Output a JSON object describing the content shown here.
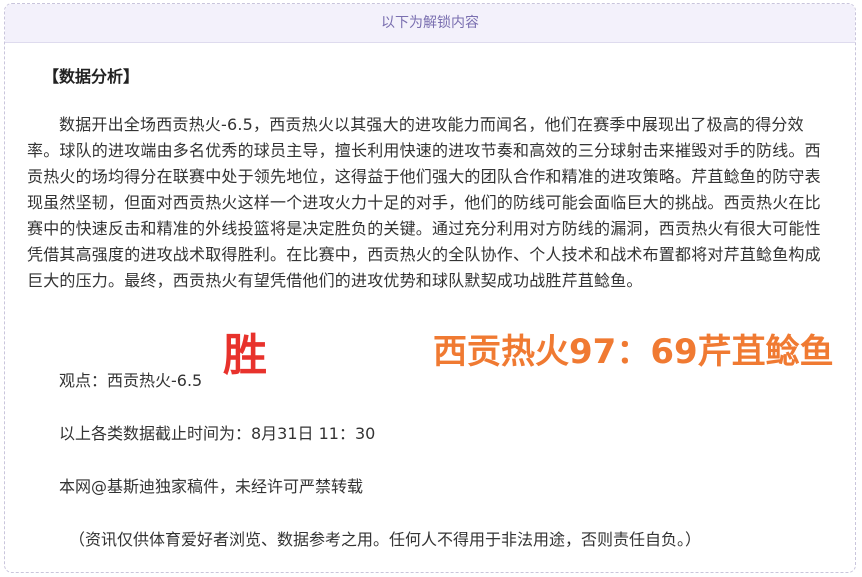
{
  "banner": {
    "label": "以下为解锁内容"
  },
  "article": {
    "heading": "【数据分析】",
    "body": "数据开出全场西贡热火-6.5，西贡热火以其强大的进攻能力而闻名，他们在赛季中展现出了极高的得分效率。球队的进攻端由多名优秀的球员主导，擅长利用快速的进攻节奏和高效的三分球射击来摧毁对手的防线。西贡热火的场均得分在联赛中处于领先地位，这得益于他们强大的团队合作和精准的进攻策略。芹苴鲶鱼的防守表现虽然坚韧，但面对西贡热火这样一个进攻火力十足的对手，他们的防线可能会面临巨大的挑战。西贡热火在比赛中的快速反击和精准的外线投篮将是决定胜负的关键。通过充分利用对方防线的漏洞，西贡热火有很大可能性凭借其高强度的进攻战术取得胜利。在比赛中，西贡热火的全队协作、个人技术和战术布置都将对芹苴鲶鱼构成巨大的压力。最终，西贡热火有望凭借他们的进攻优势和球队默契成功战胜芹苴鲶鱼。",
    "view_line": "观点：西贡热火-6.5",
    "cutoff_line": "以上各类数据截止时间为：8月31日 11：30",
    "copyright_line": "本网@基斯迪独家稿件，未经许可严禁转载",
    "disclaimer": "（资讯仅供体育爱好者浏览、数据参考之用。任何人不得用于非法用途，否则责任自负。）"
  },
  "overlay": {
    "win_text": "胜",
    "score_text": "西贡热火97：69芹苴鲶鱼",
    "win_color": "#e8322c",
    "score_color": "#f07a32"
  }
}
